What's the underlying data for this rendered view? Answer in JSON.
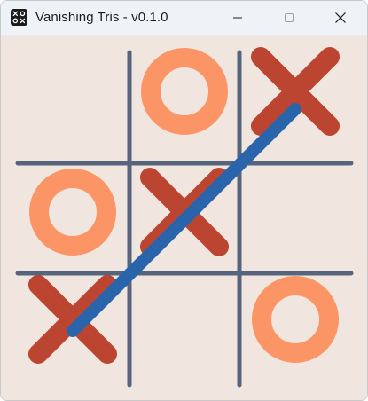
{
  "window": {
    "title": "Vanishing Tris - v0.1.0",
    "app_icon": "tic-tac-toe-icon",
    "controls": [
      "minimize-icon",
      "maximize-icon",
      "close-icon"
    ]
  },
  "board": {
    "rows": 3,
    "cols": 3,
    "cells": [
      [
        "",
        "O",
        "X"
      ],
      [
        "O",
        "X",
        ""
      ],
      [
        "X",
        "",
        "O"
      ]
    ],
    "winning_line": {
      "from_cell": [
        2,
        0
      ],
      "to_cell": [
        0,
        2
      ]
    }
  },
  "colors": {
    "background": "#f0e6df",
    "titlebar": "#eef3f8",
    "grid": "#56647c",
    "x_mark": "#bb4530",
    "o_mark": "#fc9566",
    "winning_line": "#2a65ac"
  }
}
